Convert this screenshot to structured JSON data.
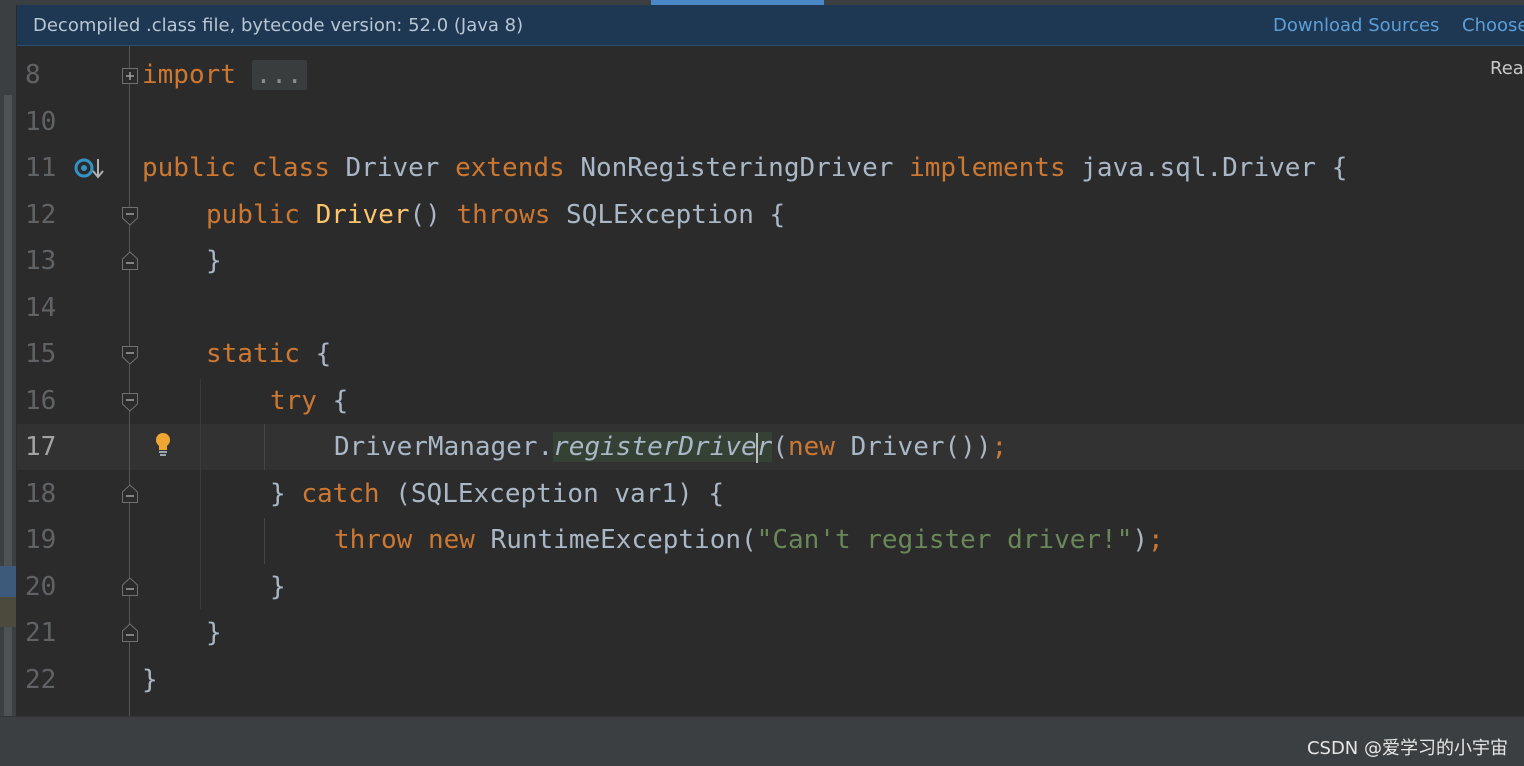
{
  "banner": {
    "message": "Decompiled .class file, bytecode version: 52.0 (Java 8)",
    "download_sources": "Download Sources",
    "choose_sources": "Choose"
  },
  "reader_mode": "Rea",
  "gutter": {
    "line_numbers": [
      "8",
      "10",
      "11",
      "12",
      "13",
      "14",
      "15",
      "16",
      "17",
      "18",
      "19",
      "20",
      "21",
      "22"
    ],
    "active_line": "17"
  },
  "code": {
    "l8": {
      "kw": "import",
      "folded": "..."
    },
    "l11": {
      "kw1": "public",
      "kw2": "class",
      "name": "Driver",
      "kw3": "extends",
      "super": "NonRegisteringDriver",
      "kw4": "implements",
      "iface": "java.sql.Driver",
      "brace": " {"
    },
    "l12": {
      "kw": "public",
      "ctor": "Driver",
      "parens": "() ",
      "kw2": "throws",
      "exc": " SQLException {"
    },
    "l13": {
      "text": "}"
    },
    "l15": {
      "kw": "static",
      "brace": " {"
    },
    "l16": {
      "kw": "try",
      "brace": " {"
    },
    "l17": {
      "cls": "DriverManager.",
      "method_a": "registerDrive",
      "method_b": "r",
      "open": "(",
      "kw": "new",
      "rest": " Driver())",
      "semi": ";"
    },
    "l18": {
      "close": "} ",
      "kw": "catch",
      "rest": " (SQLException var1) {"
    },
    "l19": {
      "kw1": "throw",
      "kw2": "new",
      "cls": " RuntimeException(",
      "str": "\"Can't register driver!\"",
      "close": ")",
      "semi": ";"
    },
    "l20": {
      "text": "}"
    },
    "l21": {
      "text": "}"
    },
    "l22": {
      "text": "}"
    }
  },
  "watermark": "CSDN @爱学习的小宇宙",
  "icons": {
    "implements_marker": "implementation-gutter-icon",
    "intention": "lightbulb-icon",
    "fold": "fold-icon"
  },
  "colors": {
    "background": "#2b2b2b",
    "keyword": "#cc7832",
    "method": "#ffc66d",
    "string": "#6a8759",
    "text": "#a9b7c6",
    "link": "#5c9fd8"
  }
}
